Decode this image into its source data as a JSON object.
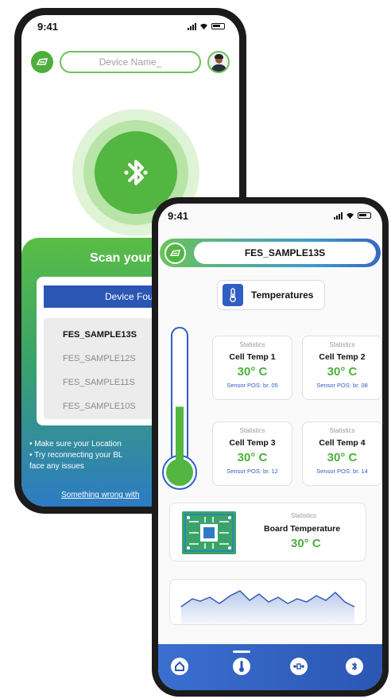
{
  "scan_screen": {
    "status_time": "9:41",
    "search": {
      "placeholder": "Device Name_"
    },
    "title": "Scan your B",
    "found_label": "Device Foun",
    "devices": [
      "FES_SAMPLE13S",
      "FES_SAMPLE12S",
      "FES_SAMPLE11S",
      "FES_SAMPLE10S"
    ],
    "selected_device_index": 0,
    "tips": [
      "•  Make sure your Location",
      "•  Try reconnecting your BL",
      "    face any issues"
    ],
    "help_link": "Something wrong with"
  },
  "temps_screen": {
    "status_time": "9:41",
    "device_name": "FES_SAMPLE13S",
    "tab_label": "Temperatures",
    "thermometer_level": 0.45,
    "cells": [
      {
        "label": "Statistics",
        "name": "Cell Temp 1",
        "value": "30° C",
        "sensor": "Sensor POS: br. 05"
      },
      {
        "label": "Statistics",
        "name": "Cell Temp 2",
        "value": "30° C",
        "sensor": "Sensor POS: br. 08"
      },
      {
        "label": "Statistics",
        "name": "Cell Temp 3",
        "value": "30° C",
        "sensor": "Sensor POS: br. 12"
      },
      {
        "label": "Statistics",
        "name": "Cell Temp 4",
        "value": "30° C",
        "sensor": "Sensor POS: br. 14"
      }
    ],
    "board": {
      "label": "Statistics",
      "name": "Board Temperature",
      "value": "30° C"
    },
    "nav": {
      "items": [
        "home-icon",
        "thermometer-icon",
        "connector-icon",
        "bluetooth-icon"
      ],
      "active_index": 1
    }
  },
  "colors": {
    "brand_green": "#52b641",
    "brand_blue": "#2b56b4",
    "value_green": "#4caf3c"
  }
}
